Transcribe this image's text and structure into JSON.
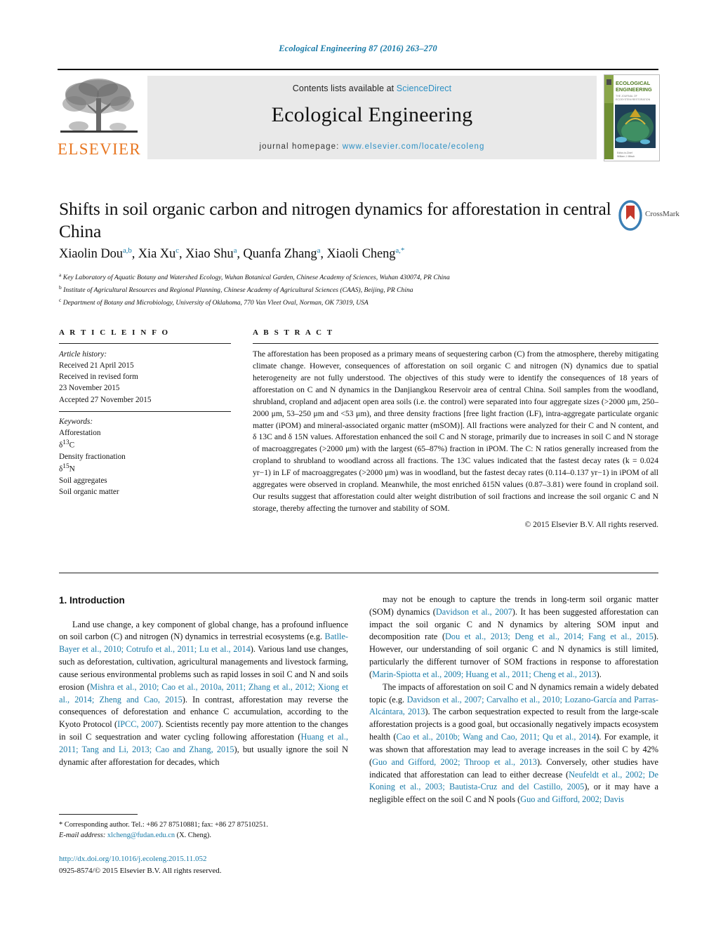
{
  "running_head": "Ecological Engineering 87 (2016) 263–270",
  "masthead": {
    "publisher_name": "ELSEVIER",
    "contents_prefix": "Contents lists available at ",
    "contents_link": "ScienceDirect",
    "journal_title": "Ecological Engineering",
    "homepage_prefix": "journal homepage: ",
    "homepage_url": "www.elsevier.com/locate/ecoleng",
    "cover_title_line1": "ECOLOGICAL",
    "cover_title_line2": "ENGINEERING"
  },
  "article": {
    "title": "Shifts in soil organic carbon and nitrogen dynamics for afforestation in central China",
    "crossmark_label": "CrossMark",
    "authors_html": "Xiaolin Dou<sup>a,b</sup>, Xia Xu<sup>c</sup>, Xiao Shu<sup>a</sup>, Quanfa Zhang<sup>a</sup>, Xiaoli Cheng<sup>a,*</sup>",
    "affiliations": [
      {
        "mark": "a",
        "text": "Key Laboratory of Aquatic Botany and Watershed Ecology, Wuhan Botanical Garden, Chinese Academy of Sciences, Wuhan 430074, PR China"
      },
      {
        "mark": "b",
        "text": "Institute of Agricultural Resources and Regional Planning, Chinese Academy of Agricultural Sciences (CAAS), Beijing, PR China"
      },
      {
        "mark": "c",
        "text": "Department of Botany and Microbiology, University of Oklahoma, 770 Van Vleet Oval, Norman, OK 73019, USA"
      }
    ]
  },
  "article_info": {
    "heading": "A R T I C L E   I N F O",
    "history_label": "Article history:",
    "history": [
      "Received 21 April 2015",
      "Received in revised form",
      "23 November 2015",
      "Accepted 27 November 2015"
    ],
    "keywords_label": "Keywords:",
    "keywords": [
      "Afforestation",
      "δ13C",
      "Density fractionation",
      "δ15N",
      "Soil aggregates",
      "Soil organic matter"
    ]
  },
  "abstract": {
    "heading": "A B S T R A C T",
    "text": "The afforestation has been proposed as a primary means of sequestering carbon (C) from the atmosphere, thereby mitigating climate change. However, consequences of afforestation on soil organic C and nitrogen (N) dynamics due to spatial heterogeneity are not fully understood. The objectives of this study were to identify the consequences of 18 years of afforestation on C and N dynamics in the Danjiangkou Reservoir area of central China. Soil samples from the woodland, shrubland, cropland and adjacent open area soils (i.e. the control) were separated into four aggregate sizes (>2000 μm, 250–2000 μm, 53–250 μm and <53 μm), and three density fractions [free light fraction (LF), intra-aggregate particulate organic matter (iPOM) and mineral-associated organic matter (mSOM)]. All fractions were analyzed for their C and N content, and δ 13C and δ 15N values. Afforestation enhanced the soil C and N storage, primarily due to increases in soil C and N storage of macroaggregates (>2000 μm) with the largest (65–87%) fraction in iPOM. The C: N ratios generally increased from the cropland to shrubland to woodland across all fractions. The 13C values indicated that the fastest decay rates (k = 0.024 yr−1) in LF of macroaggregates (>2000 μm) was in woodland, but the fastest decay rates (0.114–0.137 yr−1) in iPOM of all aggregates were observed in cropland. Meanwhile, the most enriched δ15N values (0.87–3.81) were found in cropland soil. Our results suggest that afforestation could alter weight distribution of soil fractions and increase the soil organic C and N storage, thereby affecting the turnover and stability of SOM.",
    "copyright": "© 2015 Elsevier B.V. All rights reserved."
  },
  "body": {
    "section_number_title": "1.  Introduction",
    "left_paragraph_1_parts": [
      {
        "t": "Land use change, a key component of global change, has a profound influence on soil carbon (C) and nitrogen (N) dynamics in terrestrial ecosystems (e.g. ",
        "cit": false
      },
      {
        "t": "Batlle-Bayer et al., 2010; Cotrufo et al., 2011; Lu et al., 2014",
        "cit": true
      },
      {
        "t": "). Various land use changes, such as deforestation, cultivation, agricultural managements and livestock farming, cause serious environmental problems such as rapid losses in soil C and N and soils erosion (",
        "cit": false
      },
      {
        "t": "Mishra et al., 2010; Cao et al., 2010a, 2011; Zhang et al., 2012; Xiong et al., 2014; Zheng and Cao, 2015",
        "cit": true
      },
      {
        "t": "). In contrast, afforestation may reverse the consequences of deforestation and enhance C accumulation, according to the Kyoto Protocol (",
        "cit": false
      },
      {
        "t": "IPCC, 2007",
        "cit": true
      },
      {
        "t": "). Scientists recently pay more attention to the changes in soil C sequestration and water cycling following afforestation (",
        "cit": false
      },
      {
        "t": "Huang et al., 2011; Tang and Li, 2013; Cao and Zhang, 2015",
        "cit": true
      },
      {
        "t": "), but usually ignore the soil N dynamic after afforestation for decades, which",
        "cit": false
      }
    ],
    "right_paragraph_1_parts": [
      {
        "t": "may not be enough to capture the trends in long-term soil organic matter (SOM) dynamics (",
        "cit": false
      },
      {
        "t": "Davidson et al., 2007",
        "cit": true
      },
      {
        "t": "). It has been suggested afforestation can impact the soil organic C and N dynamics by altering SOM input and decomposition rate (",
        "cit": false
      },
      {
        "t": "Dou et al., 2013; Deng et al., 2014; Fang et al., 2015",
        "cit": true
      },
      {
        "t": "). However, our understanding of soil organic C and N dynamics is still limited, particularly the different turnover of SOM fractions in response to afforestation (",
        "cit": false
      },
      {
        "t": "Marin-Spiotta et al., 2009; Huang et al., 2011; Cheng et al., 2013",
        "cit": true
      },
      {
        "t": ").",
        "cit": false
      }
    ],
    "right_paragraph_2_parts": [
      {
        "t": "The impacts of afforestation on soil C and N dynamics remain a widely debated topic (e.g. ",
        "cit": false
      },
      {
        "t": "Davidson et al., 2007; Carvalho et al., 2010; Lozano-García and Parras-Alcántara, 2013",
        "cit": true
      },
      {
        "t": "). The carbon sequestration expected to result from the large-scale afforestation projects is a good goal, but occasionally negatively impacts ecosystem health (",
        "cit": false
      },
      {
        "t": "Cao et al., 2010b; Wang and Cao, 2011; Qu et al., 2014",
        "cit": true
      },
      {
        "t": "). For example, it was shown that afforestation may lead to average increases in the soil C by 42% (",
        "cit": false
      },
      {
        "t": "Guo and Gifford, 2002; Throop et al., 2013",
        "cit": true
      },
      {
        "t": "). Conversely, other studies have indicated that afforestation can lead to either decrease (",
        "cit": false
      },
      {
        "t": "Neufeldt et al., 2002; De Koning et al., 2003; Bautista-Cruz and del Castillo, 2005",
        "cit": true
      },
      {
        "t": "), or it may have a negligible effect on the soil C and N pools (",
        "cit": false
      },
      {
        "t": "Guo and Gifford, 2002; Davis",
        "cit": true
      }
    ]
  },
  "footer": {
    "corresponding_line": "* Corresponding author. Tel.: +86 27 87510881; fax: +86 27 87510251.",
    "email_label": "E-mail address:",
    "email": "xlcheng@fudan.edu.cn",
    "email_suffix": "(X. Cheng).",
    "doi": "http://dx.doi.org/10.1016/j.ecoleng.2015.11.052",
    "issn_line": "0925-8574/© 2015 Elsevier B.V. All rights reserved."
  },
  "colors": {
    "link": "#1a7ba8",
    "elsevier_orange": "#E87722",
    "sciencedirect_blue": "#2b8fc4",
    "band_grey": "#e9e9e9"
  }
}
